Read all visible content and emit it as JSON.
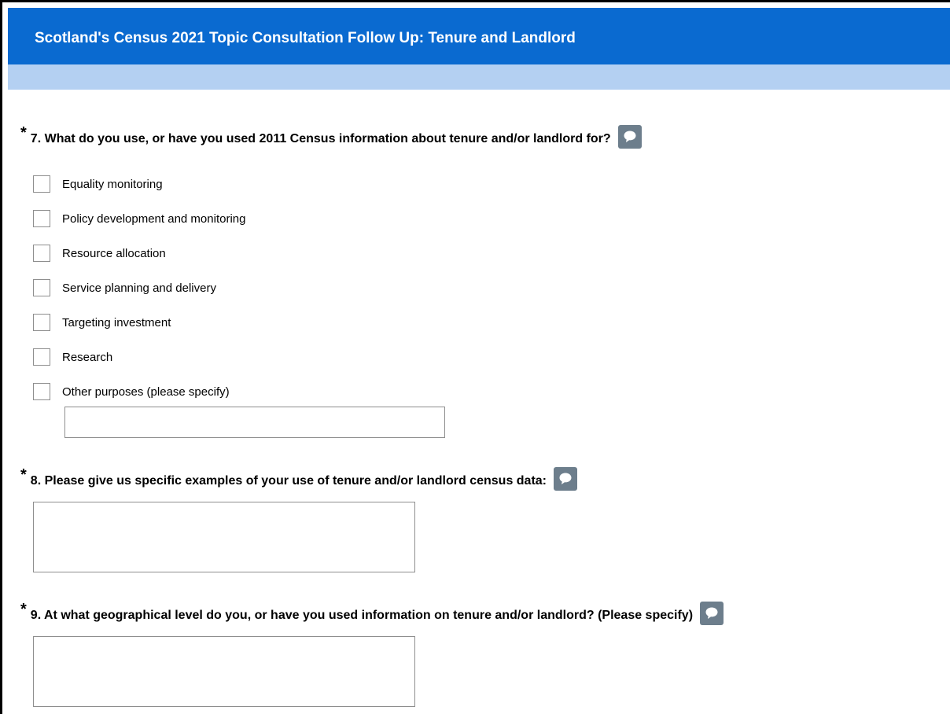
{
  "header": {
    "title": "Scotland's Census 2021 Topic Consultation Follow Up: Tenure and Landlord",
    "bar_color": "#0a6ad0",
    "band_color": "#b4d0f2"
  },
  "questions": [
    {
      "required_marker": "*",
      "text": "7. What do you use, or have you used 2011 Census information about tenure and/or landlord for?",
      "comment_icon": "comment-icon",
      "options": [
        {
          "label": "Equality monitoring",
          "checked": false
        },
        {
          "label": "Policy development and monitoring",
          "checked": false
        },
        {
          "label": "Resource allocation",
          "checked": false
        },
        {
          "label": "Service planning and delivery",
          "checked": false
        },
        {
          "label": "Targeting investment",
          "checked": false
        },
        {
          "label": "Research",
          "checked": false
        },
        {
          "label": "Other purposes (please specify)",
          "checked": false
        }
      ],
      "other_value": ""
    },
    {
      "required_marker": "*",
      "text": "8. Please give us specific examples of your use of tenure and/or landlord census data:",
      "comment_icon": "comment-icon",
      "answer_value": ""
    },
    {
      "required_marker": "*",
      "text": "9. At what geographical level do you, or have you used information on tenure and/or landlord? (Please specify)",
      "comment_icon": "comment-icon",
      "answer_value": ""
    }
  ]
}
